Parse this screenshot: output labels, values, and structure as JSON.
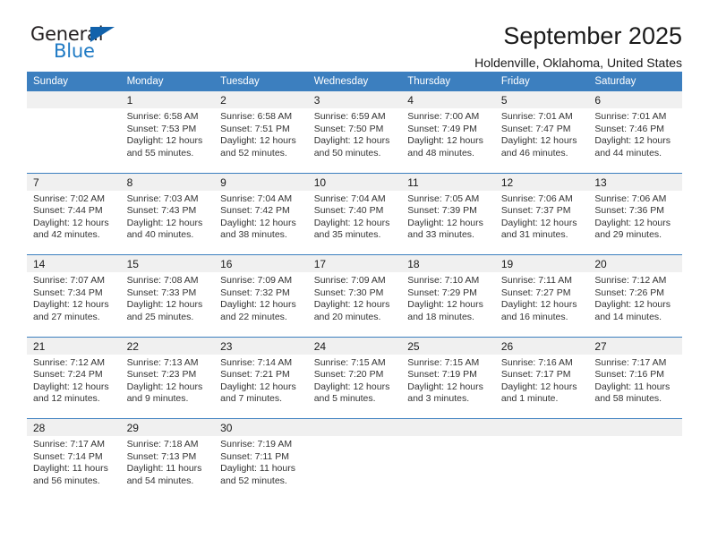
{
  "brand": {
    "name_top": "General",
    "name_bottom": "Blue",
    "triangle_icon": "triangle-icon",
    "color_dark": "#231f20",
    "color_blue": "#1f7ac4",
    "color_triangle": "#1162ab"
  },
  "header": {
    "title": "September 2025",
    "subtitle": "Holdenville, Oklahoma, United States"
  },
  "colors": {
    "header_blue": "#3c7fbf",
    "daynum_band": "#f0f0f0",
    "cell_white": "#ffffff",
    "text": "#1a1a1a"
  },
  "weekdays": [
    "Sunday",
    "Monday",
    "Tuesday",
    "Wednesday",
    "Thursday",
    "Friday",
    "Saturday"
  ],
  "weeks": [
    {
      "days": [
        {
          "num": "",
          "sunrise": "",
          "sunset": "",
          "daylight1": "",
          "daylight2": ""
        },
        {
          "num": "1",
          "sunrise": "Sunrise: 6:58 AM",
          "sunset": "Sunset: 7:53 PM",
          "daylight1": "Daylight: 12 hours",
          "daylight2": "and 55 minutes."
        },
        {
          "num": "2",
          "sunrise": "Sunrise: 6:58 AM",
          "sunset": "Sunset: 7:51 PM",
          "daylight1": "Daylight: 12 hours",
          "daylight2": "and 52 minutes."
        },
        {
          "num": "3",
          "sunrise": "Sunrise: 6:59 AM",
          "sunset": "Sunset: 7:50 PM",
          "daylight1": "Daylight: 12 hours",
          "daylight2": "and 50 minutes."
        },
        {
          "num": "4",
          "sunrise": "Sunrise: 7:00 AM",
          "sunset": "Sunset: 7:49 PM",
          "daylight1": "Daylight: 12 hours",
          "daylight2": "and 48 minutes."
        },
        {
          "num": "5",
          "sunrise": "Sunrise: 7:01 AM",
          "sunset": "Sunset: 7:47 PM",
          "daylight1": "Daylight: 12 hours",
          "daylight2": "and 46 minutes."
        },
        {
          "num": "6",
          "sunrise": "Sunrise: 7:01 AM",
          "sunset": "Sunset: 7:46 PM",
          "daylight1": "Daylight: 12 hours",
          "daylight2": "and 44 minutes."
        }
      ]
    },
    {
      "days": [
        {
          "num": "7",
          "sunrise": "Sunrise: 7:02 AM",
          "sunset": "Sunset: 7:44 PM",
          "daylight1": "Daylight: 12 hours",
          "daylight2": "and 42 minutes."
        },
        {
          "num": "8",
          "sunrise": "Sunrise: 7:03 AM",
          "sunset": "Sunset: 7:43 PM",
          "daylight1": "Daylight: 12 hours",
          "daylight2": "and 40 minutes."
        },
        {
          "num": "9",
          "sunrise": "Sunrise: 7:04 AM",
          "sunset": "Sunset: 7:42 PM",
          "daylight1": "Daylight: 12 hours",
          "daylight2": "and 38 minutes."
        },
        {
          "num": "10",
          "sunrise": "Sunrise: 7:04 AM",
          "sunset": "Sunset: 7:40 PM",
          "daylight1": "Daylight: 12 hours",
          "daylight2": "and 35 minutes."
        },
        {
          "num": "11",
          "sunrise": "Sunrise: 7:05 AM",
          "sunset": "Sunset: 7:39 PM",
          "daylight1": "Daylight: 12 hours",
          "daylight2": "and 33 minutes."
        },
        {
          "num": "12",
          "sunrise": "Sunrise: 7:06 AM",
          "sunset": "Sunset: 7:37 PM",
          "daylight1": "Daylight: 12 hours",
          "daylight2": "and 31 minutes."
        },
        {
          "num": "13",
          "sunrise": "Sunrise: 7:06 AM",
          "sunset": "Sunset: 7:36 PM",
          "daylight1": "Daylight: 12 hours",
          "daylight2": "and 29 minutes."
        }
      ]
    },
    {
      "days": [
        {
          "num": "14",
          "sunrise": "Sunrise: 7:07 AM",
          "sunset": "Sunset: 7:34 PM",
          "daylight1": "Daylight: 12 hours",
          "daylight2": "and 27 minutes."
        },
        {
          "num": "15",
          "sunrise": "Sunrise: 7:08 AM",
          "sunset": "Sunset: 7:33 PM",
          "daylight1": "Daylight: 12 hours",
          "daylight2": "and 25 minutes."
        },
        {
          "num": "16",
          "sunrise": "Sunrise: 7:09 AM",
          "sunset": "Sunset: 7:32 PM",
          "daylight1": "Daylight: 12 hours",
          "daylight2": "and 22 minutes."
        },
        {
          "num": "17",
          "sunrise": "Sunrise: 7:09 AM",
          "sunset": "Sunset: 7:30 PM",
          "daylight1": "Daylight: 12 hours",
          "daylight2": "and 20 minutes."
        },
        {
          "num": "18",
          "sunrise": "Sunrise: 7:10 AM",
          "sunset": "Sunset: 7:29 PM",
          "daylight1": "Daylight: 12 hours",
          "daylight2": "and 18 minutes."
        },
        {
          "num": "19",
          "sunrise": "Sunrise: 7:11 AM",
          "sunset": "Sunset: 7:27 PM",
          "daylight1": "Daylight: 12 hours",
          "daylight2": "and 16 minutes."
        },
        {
          "num": "20",
          "sunrise": "Sunrise: 7:12 AM",
          "sunset": "Sunset: 7:26 PM",
          "daylight1": "Daylight: 12 hours",
          "daylight2": "and 14 minutes."
        }
      ]
    },
    {
      "days": [
        {
          "num": "21",
          "sunrise": "Sunrise: 7:12 AM",
          "sunset": "Sunset: 7:24 PM",
          "daylight1": "Daylight: 12 hours",
          "daylight2": "and 12 minutes."
        },
        {
          "num": "22",
          "sunrise": "Sunrise: 7:13 AM",
          "sunset": "Sunset: 7:23 PM",
          "daylight1": "Daylight: 12 hours",
          "daylight2": "and 9 minutes."
        },
        {
          "num": "23",
          "sunrise": "Sunrise: 7:14 AM",
          "sunset": "Sunset: 7:21 PM",
          "daylight1": "Daylight: 12 hours",
          "daylight2": "and 7 minutes."
        },
        {
          "num": "24",
          "sunrise": "Sunrise: 7:15 AM",
          "sunset": "Sunset: 7:20 PM",
          "daylight1": "Daylight: 12 hours",
          "daylight2": "and 5 minutes."
        },
        {
          "num": "25",
          "sunrise": "Sunrise: 7:15 AM",
          "sunset": "Sunset: 7:19 PM",
          "daylight1": "Daylight: 12 hours",
          "daylight2": "and 3 minutes."
        },
        {
          "num": "26",
          "sunrise": "Sunrise: 7:16 AM",
          "sunset": "Sunset: 7:17 PM",
          "daylight1": "Daylight: 12 hours",
          "daylight2": "and 1 minute."
        },
        {
          "num": "27",
          "sunrise": "Sunrise: 7:17 AM",
          "sunset": "Sunset: 7:16 PM",
          "daylight1": "Daylight: 11 hours",
          "daylight2": "and 58 minutes."
        }
      ]
    },
    {
      "days": [
        {
          "num": "28",
          "sunrise": "Sunrise: 7:17 AM",
          "sunset": "Sunset: 7:14 PM",
          "daylight1": "Daylight: 11 hours",
          "daylight2": "and 56 minutes."
        },
        {
          "num": "29",
          "sunrise": "Sunrise: 7:18 AM",
          "sunset": "Sunset: 7:13 PM",
          "daylight1": "Daylight: 11 hours",
          "daylight2": "and 54 minutes."
        },
        {
          "num": "30",
          "sunrise": "Sunrise: 7:19 AM",
          "sunset": "Sunset: 7:11 PM",
          "daylight1": "Daylight: 11 hours",
          "daylight2": "and 52 minutes."
        },
        {
          "num": "",
          "sunrise": "",
          "sunset": "",
          "daylight1": "",
          "daylight2": ""
        },
        {
          "num": "",
          "sunrise": "",
          "sunset": "",
          "daylight1": "",
          "daylight2": ""
        },
        {
          "num": "",
          "sunrise": "",
          "sunset": "",
          "daylight1": "",
          "daylight2": ""
        },
        {
          "num": "",
          "sunrise": "",
          "sunset": "",
          "daylight1": "",
          "daylight2": ""
        }
      ]
    }
  ]
}
